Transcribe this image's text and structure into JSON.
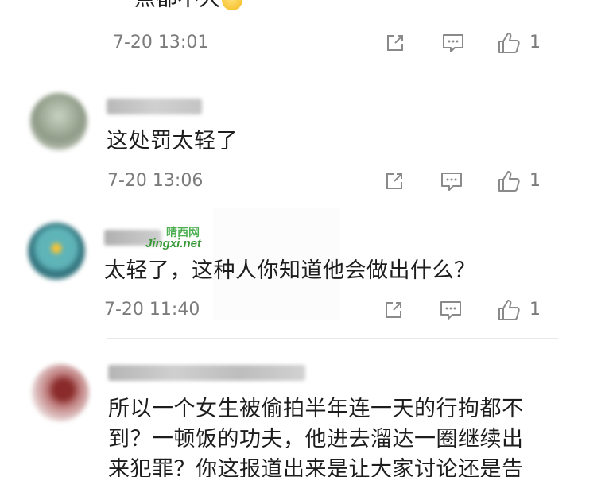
{
  "comments": [
    {
      "text": "一点都不大",
      "emoji": "smile-emoji",
      "time": "7-20 13:01",
      "likes": "1"
    },
    {
      "text": "这处罚太轻了",
      "time": "7-20 13:06",
      "likes": "1"
    },
    {
      "text": "太轻了，这种人你知道他会做出什么？",
      "time": "7-20 11:40",
      "likes": "1"
    },
    {
      "text_lines": [
        "所以一个女生被偷拍半年连一天的行拘都不",
        "到？一顿饭的功夫，他进去溜达一圈继续出",
        "来犯罪？你这报道出来是让大家讨论还是告"
      ]
    }
  ],
  "watermark": {
    "cn": "晴西网",
    "en": "Jingxi.net"
  },
  "icons": {
    "share": "share-icon",
    "reply": "comment-icon",
    "like": "thumbs-up-icon"
  },
  "colors": {
    "text": "#1d1d1d",
    "meta": "#7b7b7b",
    "icon": "#8a8a8a",
    "divider": "#e8e8e8",
    "watermark": "#4caf50"
  }
}
